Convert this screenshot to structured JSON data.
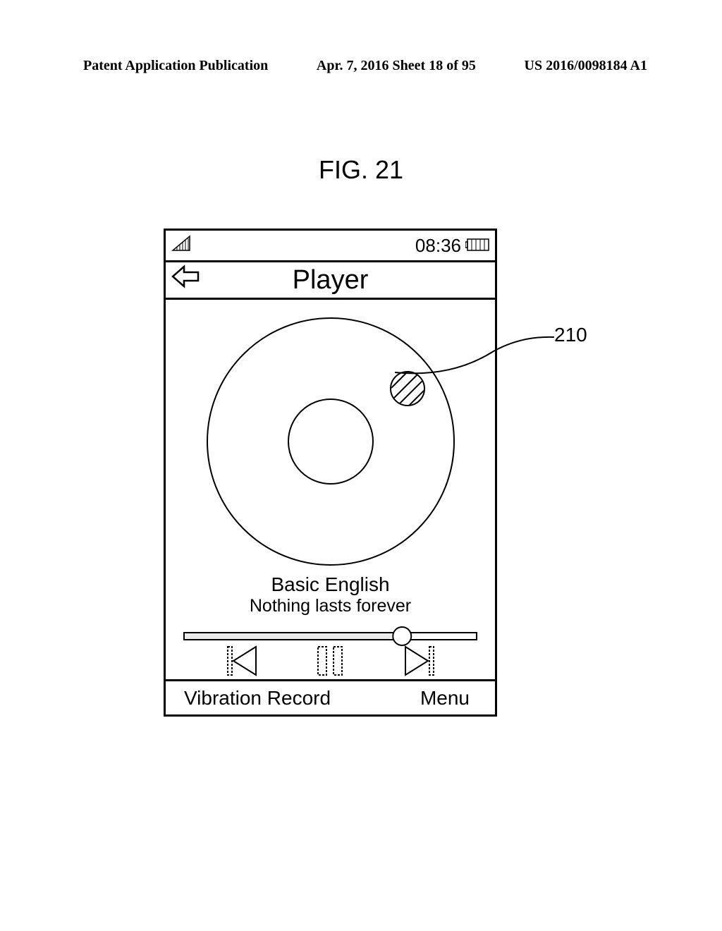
{
  "header": {
    "left": "Patent Application Publication",
    "mid": "Apr. 7, 2016  Sheet 18 of 95",
    "right": "US 2016/0098184 A1"
  },
  "figure_label": "FIG. 21",
  "status": {
    "time": "08:36"
  },
  "titlebar": {
    "title": "Player"
  },
  "track": {
    "title": "Basic English",
    "subtitle": "Nothing lasts forever"
  },
  "bottom": {
    "left": "Vibration Record",
    "right": "Menu"
  },
  "callout": {
    "ref": "210"
  }
}
